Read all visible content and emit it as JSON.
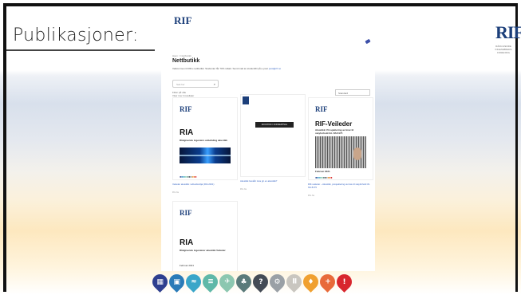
{
  "slide": {
    "title": "Publikasjoner:",
    "logo_text": "RIF",
    "logo_subtitle": "RÅDGIVENDE INGENIØRERS FORENING"
  },
  "webshop": {
    "logo_text": "RIF",
    "breadcrumb": "Hjem > Nettbutikk",
    "heading": "Nettbutikk",
    "intro_text": "Velkommen til RIFs nettbutikk. Studenter får 70% rabatt. Send mail av studentID på e-post",
    "intro_link": "post@rif.no",
    "search_placeholder": "Søk her",
    "filter_label": "Filtrer på: Alle",
    "result_count": "Viser 4 av 4 resultater",
    "sort_label": "Standard"
  },
  "products": [
    {
      "cover_logo": "RIF",
      "cover_title": "RIA",
      "cover_subtitle": "Rådgivende ingeniørs anbefaling akustikk",
      "caption": "Veileder akustikk i arbeidsmiljø (RIA 2021)",
      "price": "Pris fra"
    },
    {
      "banner": "AKUSTIKK I KONSERTSAL",
      "caption": "Akustikk bestått: Hva gir en akustikk?",
      "price": "Pris fra"
    },
    {
      "cover_logo": "RIF",
      "cover_title": "RIF-Veileder",
      "cover_subtitle": "Akustikk: Prosjektering av krav til støyforhold iht. NS 8175",
      "date": "Februar 2021",
      "caption": "RIF-veileder – Akustikk, prosjektering av krav til støyforhold iht. NS 8175",
      "price": "Pris fra"
    },
    {
      "cover_logo": "RIF",
      "cover_title": "RIA",
      "cover_subtitle": "Rådgivende ingeniører akustikk Veileder",
      "date": "Februar 2021"
    }
  ],
  "icon_row": [
    {
      "name": "building-icon",
      "glyph": "▦",
      "color": "#2e3f8f"
    },
    {
      "name": "document-icon",
      "glyph": "▣",
      "color": "#2a7bb8"
    },
    {
      "name": "water-icon",
      "glyph": "≈",
      "color": "#3aa6c9"
    },
    {
      "name": "road-icon",
      "glyph": "≡",
      "color": "#5fb8a8"
    },
    {
      "name": "plane-icon",
      "glyph": "✈",
      "color": "#8cc7b0"
    },
    {
      "name": "tree-icon",
      "glyph": "♣",
      "color": "#5a7a7a"
    },
    {
      "name": "question-icon",
      "glyph": "?",
      "color": "#444b55"
    },
    {
      "name": "gear-icon",
      "glyph": "⚙",
      "color": "#9aa0a6"
    },
    {
      "name": "pause-icon",
      "glyph": "Ⅱ",
      "color": "#c9c6c0"
    },
    {
      "name": "bulb-icon",
      "glyph": "♦",
      "color": "#f0a030"
    },
    {
      "name": "plus-icon",
      "glyph": "+",
      "color": "#e86a3a"
    },
    {
      "name": "alert-icon",
      "glyph": "!",
      "color": "#d8262e"
    }
  ]
}
